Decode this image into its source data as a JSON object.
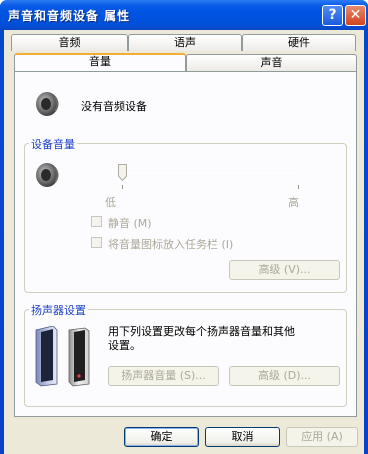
{
  "window": {
    "title": "声音和音频设备 属性",
    "help_button": "?",
    "close_button": "✕"
  },
  "tabs_row1": [
    "音频",
    "语声",
    "硬件"
  ],
  "tabs_row2": [
    "音量",
    "声音"
  ],
  "active_tab": "音量",
  "device": {
    "name": "没有音频设备"
  },
  "device_volume": {
    "group_title": "设备音量",
    "slider_min_label": "低",
    "slider_max_label": "高",
    "slider_level": 0,
    "mute_label": "静音 (M)",
    "mute_checked": false,
    "tray_label": "将音量图标放入任务栏 (I)",
    "tray_checked": false,
    "advanced_button": "高级 (V)..."
  },
  "speaker_settings": {
    "group_title": "扬声器设置",
    "description": "用下列设置更改每个扬声器音量和其他设置。",
    "speaker_volume_button": "扬声器音量 (S)...",
    "advanced_button": "高级 (D)..."
  },
  "footer": {
    "ok": "确定",
    "cancel": "取消",
    "apply": "应用 (A)"
  }
}
